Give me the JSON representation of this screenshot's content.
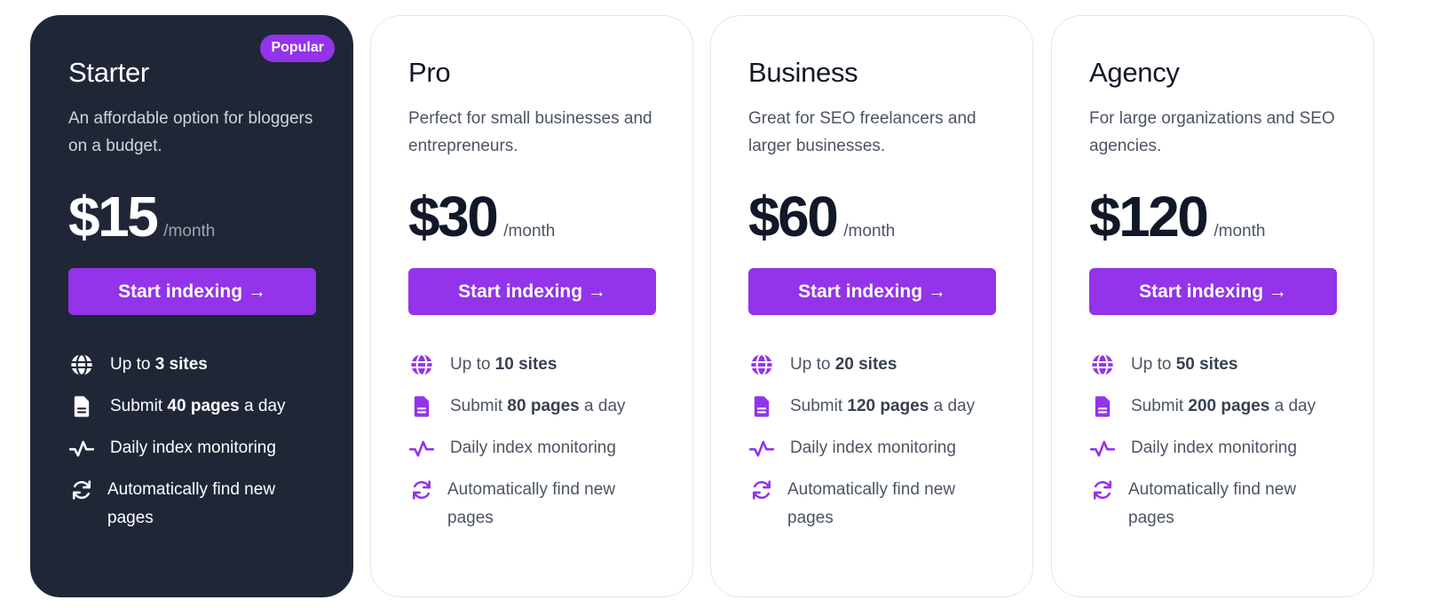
{
  "accent_color": "#9333ea",
  "dark_card_color": "#1f2737",
  "plans": [
    {
      "name": "Starter",
      "badge": "Popular",
      "description": "An affordable option for bloggers on a budget.",
      "price": "$15",
      "period": "/month",
      "cta_label": "Start indexing →",
      "features": {
        "sites": {
          "prefix": "Up to ",
          "value": "3 sites",
          "suffix": "",
          "icon": "globe-icon"
        },
        "pages": {
          "prefix": "Submit ",
          "value": "40 pages",
          "suffix": " a day",
          "icon": "document-icon"
        },
        "monitoring": {
          "text": "Daily index monitoring",
          "icon": "pulse-icon"
        },
        "discovery": {
          "text": "Automatically find new pages",
          "icon": "refresh-icon"
        }
      }
    },
    {
      "name": "Pro",
      "badge": "",
      "description": "Perfect for small businesses and entrepreneurs.",
      "price": "$30",
      "period": "/month",
      "cta_label": "Start indexing →",
      "features": {
        "sites": {
          "prefix": "Up to ",
          "value": "10 sites",
          "suffix": "",
          "icon": "globe-icon"
        },
        "pages": {
          "prefix": "Submit ",
          "value": "80 pages",
          "suffix": " a day",
          "icon": "document-icon"
        },
        "monitoring": {
          "text": "Daily index monitoring",
          "icon": "pulse-icon"
        },
        "discovery": {
          "text": "Automatically find new pages",
          "icon": "refresh-icon"
        }
      }
    },
    {
      "name": "Business",
      "badge": "",
      "description": "Great for SEO freelancers and larger businesses.",
      "price": "$60",
      "period": "/month",
      "cta_label": "Start indexing →",
      "features": {
        "sites": {
          "prefix": "Up to ",
          "value": "20 sites",
          "suffix": "",
          "icon": "globe-icon"
        },
        "pages": {
          "prefix": "Submit ",
          "value": "120 pages",
          "suffix": " a day",
          "icon": "document-icon"
        },
        "monitoring": {
          "text": "Daily index monitoring",
          "icon": "pulse-icon"
        },
        "discovery": {
          "text": "Automatically find new pages",
          "icon": "refresh-icon"
        }
      }
    },
    {
      "name": "Agency",
      "badge": "",
      "description": "For large organizations and SEO agencies.",
      "price": "$120",
      "period": "/month",
      "cta_label": "Start indexing →",
      "features": {
        "sites": {
          "prefix": "Up to ",
          "value": "50 sites",
          "suffix": "",
          "icon": "globe-icon"
        },
        "pages": {
          "prefix": "Submit ",
          "value": "200 pages",
          "suffix": " a day",
          "icon": "document-icon"
        },
        "monitoring": {
          "text": "Daily index monitoring",
          "icon": "pulse-icon"
        },
        "discovery": {
          "text": "Automatically find new pages",
          "icon": "refresh-icon"
        }
      }
    }
  ]
}
